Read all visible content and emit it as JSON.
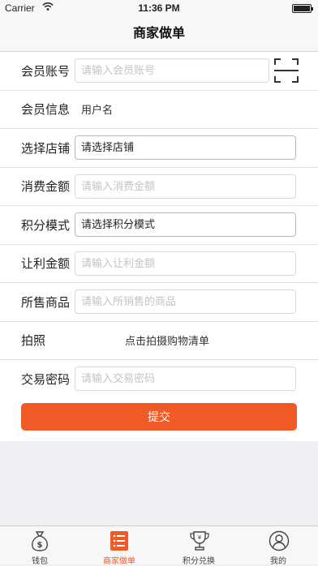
{
  "status_bar": {
    "carrier": "Carrier",
    "wifi_icon": "wifi-icon",
    "time": "11:36 PM",
    "battery_icon": "battery-icon"
  },
  "nav": {
    "title": "商家做单"
  },
  "form": {
    "member_account": {
      "label": "会员账号",
      "placeholder": "请输入会员账号",
      "scan_icon": "qr-scan-icon"
    },
    "member_info": {
      "label": "会员信息",
      "value": "用户名"
    },
    "store": {
      "label": "选择店铺",
      "value": "请选择店铺"
    },
    "amount": {
      "label": "消费金额",
      "placeholder": "请输入消费金额"
    },
    "points_mode": {
      "label": "积分模式",
      "value": "请选择积分模式"
    },
    "discount": {
      "label": "让利金额",
      "placeholder": "请输入让利金额"
    },
    "goods": {
      "label": "所售商品",
      "placeholder": "请输入所销售的商品"
    },
    "photo": {
      "label": "拍照",
      "action_text": "点击拍摄购物清单"
    },
    "password": {
      "label": "交易密码",
      "placeholder": "请输入交易密码"
    }
  },
  "submit": {
    "label": "提交",
    "color": "#ef5a26"
  },
  "tab_bar": {
    "active_color": "#ef5a26",
    "tabs": [
      {
        "label": "钱包",
        "icon": "money-bag-icon"
      },
      {
        "label": "商家做单",
        "icon": "list-icon"
      },
      {
        "label": "积分兑换",
        "icon": "trophy-icon"
      },
      {
        "label": "我的",
        "icon": "user-icon"
      }
    ]
  }
}
